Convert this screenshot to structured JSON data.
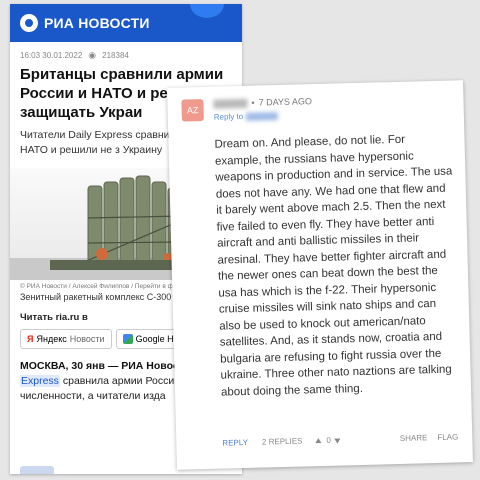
{
  "ria": {
    "brand": "РИА НОВОСТИ",
    "meta": {
      "datetime": "16:03 30.01.2022",
      "views": "218384"
    },
    "title": "Британцы сравнили армии России и НАТО и решили не защищать Украи",
    "lead": "Читатели Daily Express сравни России и НАТО и решили не з Украину",
    "photo_caption": "© РИА Новости / Алексей Филиппов / Перейти в фо",
    "photo_desc": "Зенитный ракетный комплекс С-300",
    "read_on": "Читать ria.ru в",
    "yandex_label": "Яндекс",
    "yandex_suffix": "Новости",
    "google_label": "Google Ново",
    "body_dateline": "МОСКВА, 30 янв — РИА Новост",
    "body_highlight": "Express",
    "body_rest": " сравнила армии Россий по численности, а читатели изда"
  },
  "comment": {
    "avatar_initials": "AZ",
    "time": "7 DAYS AGO",
    "reply_to_label": "Reply to",
    "text": "Dream on. And please, do not lie. For example, the russians have hypersonic weapons in production and in service. The usa does not have any. We had one that flew and it barely went above mach 2.5. Then the next five failed to even fly. They have better anti aircraft and anti ballistic missiles in their aresinal. They have better fighter aircraft and the newer ones can beat down the best the usa has which is the f-22. Their hypersonic cruise missiles will sink nato ships and can also be used to knock out american/nato satellites. And, as it stands now, croatia and bulgaria are refusing to fight russia over the ukraine. Three other nato naztions are talking about doing the same thing.",
    "actions": {
      "reply": "REPLY",
      "replies": "2 REPLIES",
      "count": "0",
      "share": "SHARE",
      "flag": "FLAG"
    }
  }
}
